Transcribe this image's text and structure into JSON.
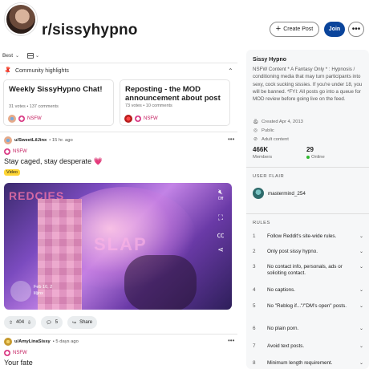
{
  "header": {
    "title": "r/sissyhypno",
    "create_post_label": "Create Post",
    "join_label": "Join",
    "more_label": "•••"
  },
  "feed_controls": {
    "sort_label": "Best"
  },
  "highlights": {
    "heading": "Community highlights",
    "cards": [
      {
        "title": "Weekly SissyHypno Chat!",
        "meta": "31 votes • 137 comments",
        "tag": "NSFW"
      },
      {
        "title": "Reposting - the MOD announcement about post a...",
        "meta": "73 votes • 10 comments",
        "tag": "NSFW"
      }
    ]
  },
  "posts": [
    {
      "user": "u/SweetLilJinx",
      "time": "• 15 hr. ago",
      "tag": "NSFW",
      "title": "Stay caged, stay desperate 💗",
      "flair": "Video",
      "media_text_1": "REDCIES",
      "media_text_2": "SLAP",
      "stamp_line_1": "Feb 10, 2",
      "stamp_line_2": "liljinx",
      "media_off": "Off",
      "votes": "404",
      "comments": "5",
      "share_label": "Share"
    },
    {
      "user": "u/AmyLinaSissy",
      "time": "• 5 days ago",
      "tag": "NSFW",
      "title": "Your fate"
    }
  ],
  "sidebar": {
    "name": "Sissy Hypno",
    "description": "NSFW Content * A Fantasy Only * : Hypnosis / conditioning media that may turn participants into sexy, cock sucking sissies. If you're under 18, you will be banned. *FYI: All posts go into a queue for MOD review before going live on the feed.",
    "created": "Created Apr 4, 2013",
    "visibility": "Public",
    "content": "Adult content",
    "members_count": "466K",
    "members_label": "Members",
    "online_count": "29",
    "online_label": "Online",
    "user_flair_heading": "USER FLAIR",
    "flair_user": "mastermind_254",
    "rules_heading": "RULES",
    "rules": [
      {
        "num": "1",
        "text": "Follow Reddit's site-wide rules."
      },
      {
        "num": "2",
        "text": "Only post sissy hypno."
      },
      {
        "num": "3",
        "text": "No contact info, personals, ads or soliciting contact."
      },
      {
        "num": "4",
        "text": "No captions."
      },
      {
        "num": "5",
        "text": "No \"Reblog if...\"/\"DM's open\" posts."
      },
      {
        "num": "6",
        "text": "No plain porn."
      },
      {
        "num": "7",
        "text": "Avoid text posts."
      },
      {
        "num": "8",
        "text": "Minimum length requirement."
      }
    ]
  }
}
